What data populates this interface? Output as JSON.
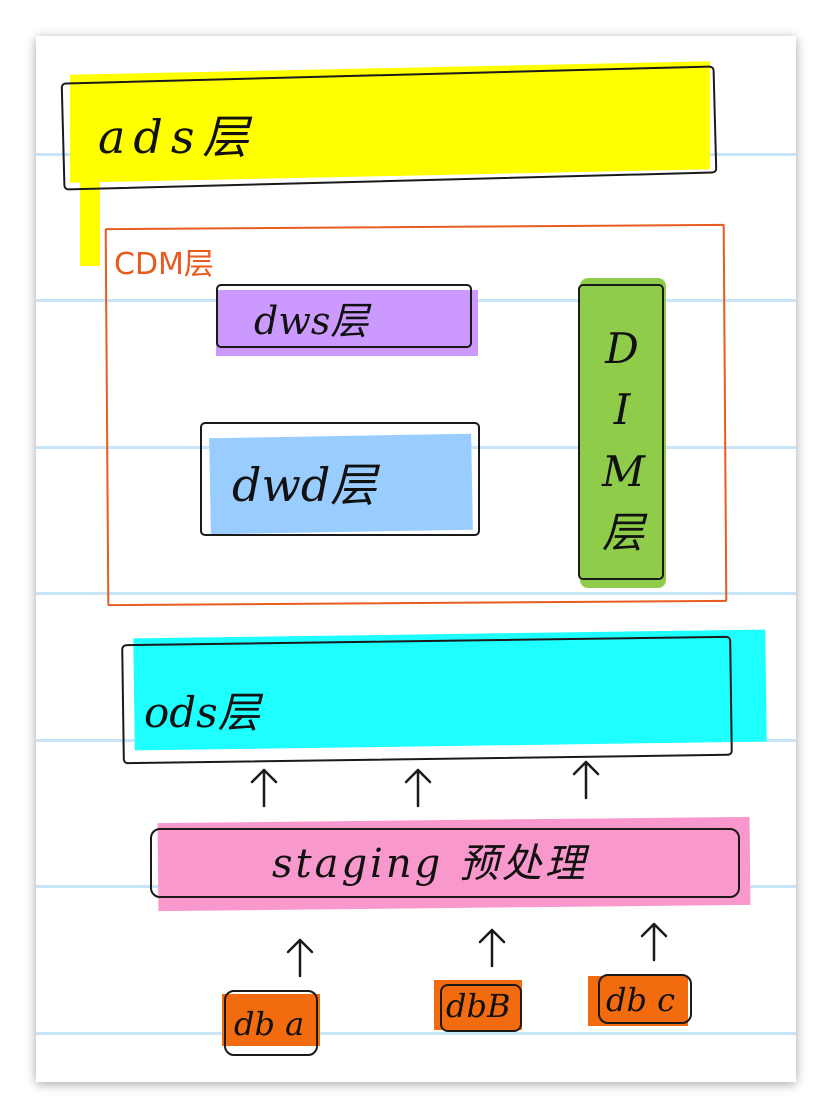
{
  "layers": {
    "ads": {
      "label": "ads层",
      "color": "#ffff00"
    },
    "cdm": {
      "label": "CDM层",
      "color": "#e85a1e",
      "dws": {
        "label": "dws层",
        "color": "#cc99ff"
      },
      "dwd": {
        "label": "dwd层",
        "color": "#99ccff"
      },
      "dim": {
        "label": "DIM层",
        "letters": [
          "D",
          "I",
          "M",
          "层"
        ],
        "color": "#8fcc4a"
      }
    },
    "ods": {
      "label": "ods层",
      "color": "#1effff"
    },
    "staging": {
      "label": "staging 预处理",
      "color": "#f898cc"
    }
  },
  "sources": [
    {
      "label": "db a",
      "color": "#f26b0f"
    },
    {
      "label": "dbB",
      "color": "#f26b0f"
    },
    {
      "label": "db c",
      "color": "#f26b0f"
    }
  ],
  "page_background": "#ffffff",
  "rule_color": "#c9e4f7",
  "ink_color": "#1a1a1a"
}
